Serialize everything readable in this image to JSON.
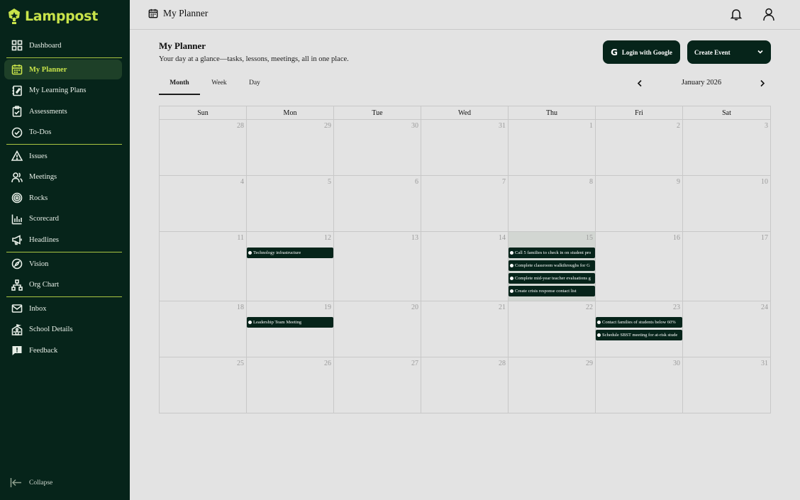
{
  "brand": {
    "name": "Lamppost",
    "color": "#c8e34a"
  },
  "sidebar": {
    "items": [
      {
        "label": "Dashboard",
        "icon": "grid-icon"
      },
      {
        "label": "My Planner",
        "icon": "calendar-icon",
        "active": true
      },
      {
        "label": "My Learning Plans",
        "icon": "notebook-icon"
      },
      {
        "label": "Assessments",
        "icon": "clipboard-icon"
      },
      {
        "label": "To-Dos",
        "icon": "check-circle-icon"
      },
      {
        "label": "Issues",
        "icon": "warning-icon"
      },
      {
        "label": "Meetings",
        "icon": "users-icon"
      },
      {
        "label": "Rocks",
        "icon": "target-icon"
      },
      {
        "label": "Scorecard",
        "icon": "bar-chart-icon"
      },
      {
        "label": "Headlines",
        "icon": "megaphone-icon"
      },
      {
        "label": "Vision",
        "icon": "compass-icon"
      },
      {
        "label": "Org Chart",
        "icon": "org-chart-icon"
      },
      {
        "label": "Inbox",
        "icon": "mail-icon"
      },
      {
        "label": "School Details",
        "icon": "school-icon"
      },
      {
        "label": "Feedback",
        "icon": "feedback-icon"
      }
    ],
    "collapse_label": "Collapse"
  },
  "topbar": {
    "title": "My Planner"
  },
  "header": {
    "title": "My Planner",
    "subtitle": "Your day at a glance—tasks, lessons, meetings, all in one place.",
    "google_button": "Login with Google",
    "create_button": "Create Event"
  },
  "tabs": [
    "Month",
    "Week",
    "Day"
  ],
  "active_tab": "Month",
  "month_label": "January 2026",
  "calendar": {
    "weekdays": [
      "Sun",
      "Mon",
      "Tue",
      "Wed",
      "Thu",
      "Fri",
      "Sat"
    ],
    "today_day": 15,
    "weeks": [
      [
        "28",
        "29",
        "30",
        "31",
        "1",
        "2",
        "3"
      ],
      [
        "4",
        "5",
        "6",
        "7",
        "8",
        "9",
        "10"
      ],
      [
        "11",
        "12",
        "13",
        "14",
        "15",
        "16",
        "17"
      ],
      [
        "18",
        "19",
        "20",
        "21",
        "22",
        "23",
        "24"
      ],
      [
        "25",
        "26",
        "27",
        "28",
        "29",
        "30",
        "31"
      ]
    ],
    "events": [
      {
        "week": 2,
        "day": 1,
        "title": "Technology infrastructure"
      },
      {
        "week": 2,
        "day": 4,
        "title": "Call 5 families to check in on student pro"
      },
      {
        "week": 2,
        "day": 4,
        "title": "Complete classroom walkthroughs for G"
      },
      {
        "week": 2,
        "day": 4,
        "title": "Complete mid-year teacher evaluations g"
      },
      {
        "week": 2,
        "day": 4,
        "title": "Create crisis response contact list"
      },
      {
        "week": 3,
        "day": 1,
        "title": "Leadership Team Meeting"
      },
      {
        "week": 3,
        "day": 5,
        "title": "Contact families of students below 60%"
      },
      {
        "week": 3,
        "day": 5,
        "title": "Schedule SBST meeting for at-risk stude"
      }
    ]
  }
}
